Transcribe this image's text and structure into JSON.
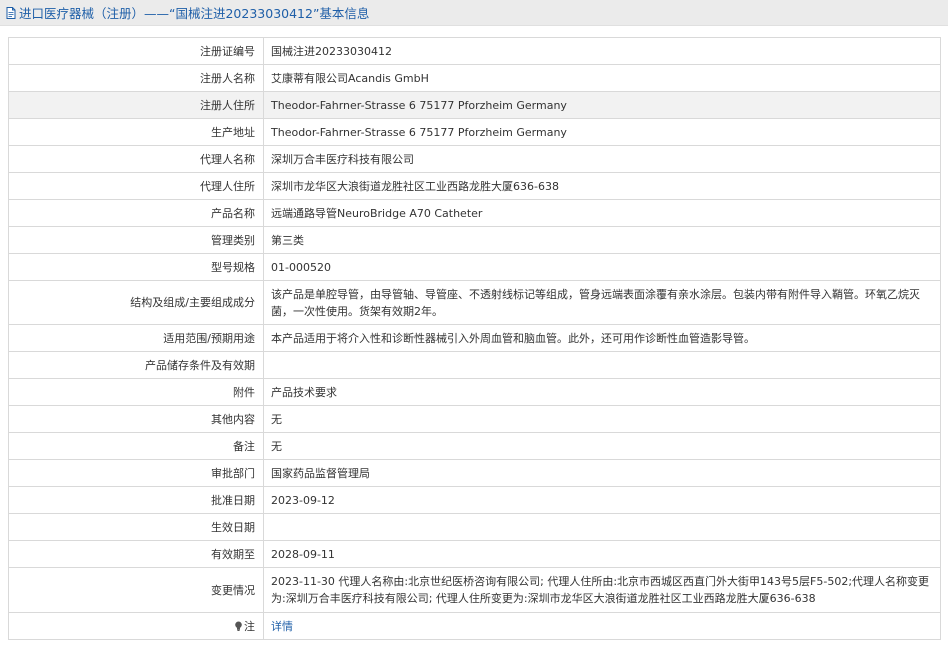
{
  "header": {
    "title": "进口医疗器械（注册）——“国械注进20233030412”基本信息",
    "title_color": "#1f5fa8"
  },
  "rows": [
    {
      "label": "注册证编号",
      "value": "国械注进20233030412"
    },
    {
      "label": "注册人名称",
      "value": "艾康蒂有限公司Acandis GmbH"
    },
    {
      "label": "注册人住所",
      "value": "Theodor-Fahrner-Strasse 6 75177 Pforzheim Germany"
    },
    {
      "label": "生产地址",
      "value": "Theodor-Fahrner-Strasse 6 75177 Pforzheim Germany"
    },
    {
      "label": "代理人名称",
      "value": "深圳万合丰医疗科技有限公司"
    },
    {
      "label": "代理人住所",
      "value": "深圳市龙华区大浪街道龙胜社区工业西路龙胜大厦636-638"
    },
    {
      "label": "产品名称",
      "value": "远端通路导管NeuroBridge A70 Catheter"
    },
    {
      "label": "管理类别",
      "value": "第三类"
    },
    {
      "label": "型号规格",
      "value": "01-000520"
    },
    {
      "label": "结构及组成/主要组成成分",
      "value": "该产品是单腔导管，由导管轴、导管座、不透射线标记等组成，管身远端表面涂覆有亲水涂层。包装内带有附件导入鞘管。环氧乙烷灭菌，一次性使用。货架有效期2年。"
    },
    {
      "label": "适用范围/预期用途",
      "value": "本产品适用于将介入性和诊断性器械引入外周血管和脑血管。此外，还可用作诊断性血管造影导管。"
    },
    {
      "label": "产品储存条件及有效期",
      "value": ""
    },
    {
      "label": "附件",
      "value": "产品技术要求"
    },
    {
      "label": "其他内容",
      "value": "无"
    },
    {
      "label": "备注",
      "value": "无"
    },
    {
      "label": "审批部门",
      "value": "国家药品监督管理局"
    },
    {
      "label": "批准日期",
      "value": "2023-09-12"
    },
    {
      "label": "生效日期",
      "value": ""
    },
    {
      "label": "有效期至",
      "value": "2028-09-11"
    },
    {
      "label": "变更情况",
      "value": "2023-11-30 代理人名称由:北京世纪医桥咨询有限公司; 代理人住所由:北京市西城区西直门外大街甲143号5层F5-502;代理人名称变更为:深圳万合丰医疗科技有限公司; 代理人住所变更为:深圳市龙华区大浪街道龙胜社区工业西路龙胜大厦636-638"
    }
  ],
  "note": {
    "label": "注",
    "link_text": "详情",
    "icon": "lightbulb-icon"
  },
  "colors": {
    "border": "#d9d9d9",
    "shaded_row": "#f2f2f2",
    "link": "#1f5fa8"
  }
}
